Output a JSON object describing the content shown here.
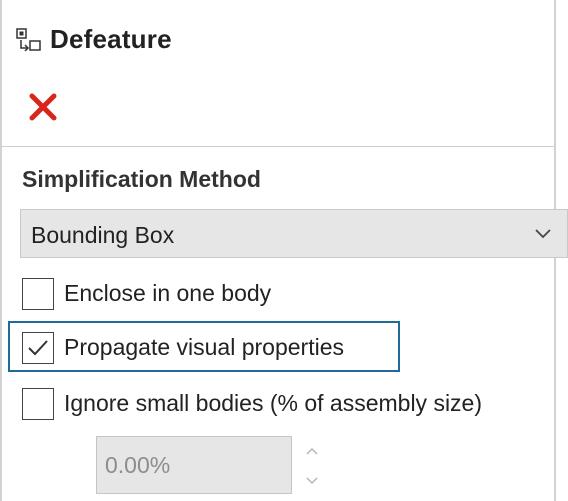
{
  "panel": {
    "title": "Defeature",
    "title_icon": "defeature-icon",
    "cancel_icon": "close-x-icon",
    "cancel_color": "#d9261c"
  },
  "simplification": {
    "section_title": "Simplification Method",
    "selected": "Bounding Box"
  },
  "options": {
    "enclose": {
      "label": "Enclose in one body",
      "checked": false
    },
    "propagate": {
      "label": "Propagate visual properties",
      "checked": true
    },
    "ignore_small": {
      "label": "Ignore small bodies (% of assembly size)",
      "checked": false
    }
  },
  "threshold": {
    "value": "0.00%"
  },
  "colors": {
    "focus_outline": "#1e6a9a",
    "input_background": "#e6e6e6"
  }
}
